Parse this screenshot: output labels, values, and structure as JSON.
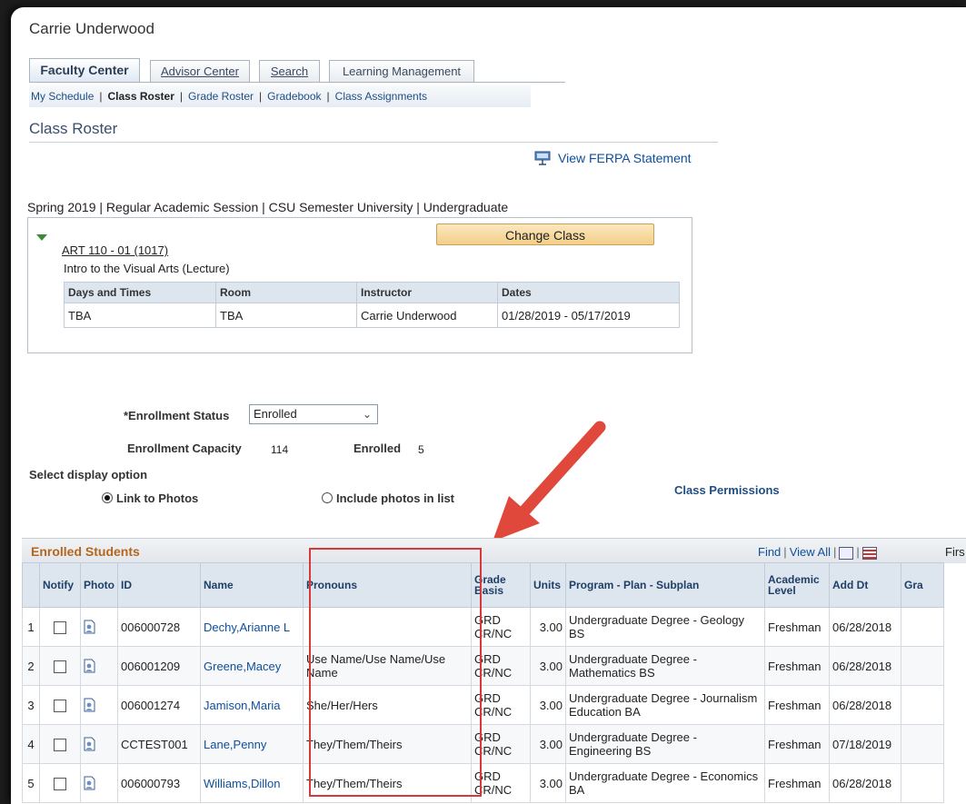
{
  "user_name": "Carrie Underwood",
  "tabs": [
    "Faculty Center",
    "Advisor Center",
    "Search",
    "Learning Management"
  ],
  "subnav": [
    "My Schedule",
    "Class Roster",
    "Grade Roster",
    "Gradebook",
    "Class Assignments"
  ],
  "page_title": "Class Roster",
  "ferpa_link": "View FERPA Statement",
  "term_line": "Spring  2019 | Regular Academic Session | CSU Semester University | Undergraduate",
  "class": {
    "code": "ART 110 - 01 (1017)",
    "description": "Intro to the Visual Arts (Lecture)",
    "change_button": "Change Class",
    "meeting_headers": [
      "Days and Times",
      "Room",
      "Instructor",
      "Dates"
    ],
    "meeting_row": [
      "TBA",
      "TBA",
      "Carrie Underwood",
      "01/28/2019 - 05/17/2019"
    ]
  },
  "enrollment": {
    "status_label": "*Enrollment Status",
    "status_value": "Enrolled",
    "capacity_label": "Enrollment Capacity",
    "capacity_value": "114",
    "enrolled_label": "Enrolled",
    "enrolled_value": "5"
  },
  "display": {
    "label": "Select display option",
    "option1": "Link to Photos",
    "option2": "Include photos in list",
    "selected": "Link to Photos"
  },
  "class_permissions": "Class Permissions",
  "roster": {
    "title": "Enrolled Students",
    "find": "Find",
    "view_all": "View All",
    "first": "Firs",
    "headers": [
      "",
      "Notify",
      "Photo",
      "ID",
      "Name",
      "Pronouns",
      "Grade Basis",
      "Units",
      "Program - Plan - Subplan",
      "Academic Level",
      "Add Dt",
      "Gra"
    ],
    "rows": [
      {
        "n": "1",
        "id": "006000728",
        "name": "Dechy,Arianne L",
        "pronouns": "",
        "basis": "GRD CR/NC",
        "units": "3.00",
        "program": "Undergraduate Degree - Geology BS",
        "level": "Freshman",
        "add_dt": "06/28/2018"
      },
      {
        "n": "2",
        "id": "006001209",
        "name": "Greene,Macey",
        "pronouns": "Use Name/Use Name/Use Name",
        "basis": "GRD CR/NC",
        "units": "3.00",
        "program": "Undergraduate Degree - Mathematics BS",
        "level": "Freshman",
        "add_dt": "06/28/2018"
      },
      {
        "n": "3",
        "id": "006001274",
        "name": "Jamison,Maria",
        "pronouns": "She/Her/Hers",
        "basis": "GRD CR/NC",
        "units": "3.00",
        "program": "Undergraduate Degree - Journalism Education BA",
        "level": "Freshman",
        "add_dt": "06/28/2018"
      },
      {
        "n": "4",
        "id": "CCTEST001",
        "name": "Lane,Penny",
        "pronouns": "They/Them/Theirs",
        "basis": "GRD CR/NC",
        "units": "3.00",
        "program": "Undergraduate Degree - Engineering BS",
        "level": "Freshman",
        "add_dt": "07/18/2019"
      },
      {
        "n": "5",
        "id": "006000793",
        "name": "Williams,Dillon",
        "pronouns": "They/Them/Theirs",
        "basis": "GRD CR/NC",
        "units": "3.00",
        "program": "Undergraduate Degree - Economics BA",
        "level": "Freshman",
        "add_dt": "06/28/2018"
      }
    ]
  },
  "colors": {
    "highlight": "#d9383a",
    "arrow": "#e0483c",
    "roster_title": "#b5661e",
    "link": "#0d4f9c"
  }
}
